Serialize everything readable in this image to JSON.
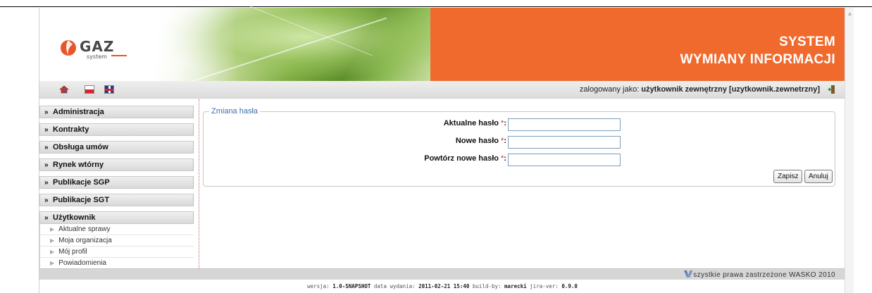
{
  "header": {
    "logo_text": "GAZ",
    "logo_subtext": "system",
    "title_line1": "SYSTEM",
    "title_line2": "WYMIANY INFORMACJI"
  },
  "toolbar": {
    "home_icon": "home-icon",
    "flags": [
      "pl-flag-icon",
      "uk-flag-icon"
    ],
    "logged_prefix": "zalogowany jako:",
    "logged_user": "użytkownik zewnętrzny [uzytkownik.zewnetrzny]",
    "logout_icon": "logout-icon"
  },
  "sidebar": {
    "items": [
      {
        "label": "Administracja",
        "expanded": false
      },
      {
        "label": "Kontrakty",
        "expanded": false
      },
      {
        "label": "Obsługa umów",
        "expanded": false
      },
      {
        "label": "Rynek wtórny",
        "expanded": false
      },
      {
        "label": "Publikacje SGP",
        "expanded": false
      },
      {
        "label": "Publikacje SGT",
        "expanded": false
      },
      {
        "label": "Użytkownik",
        "expanded": true
      }
    ],
    "subitems": [
      "Aktualne sprawy",
      "Moja organizacja",
      "Mój profil",
      "Powiadomienia"
    ]
  },
  "form": {
    "legend": "Zmiana hasła",
    "fields": [
      {
        "label": "Aktualne hasło",
        "required": "*",
        "colon": ":",
        "value": ""
      },
      {
        "label": "Nowe hasło",
        "required": "*",
        "colon": ":",
        "value": ""
      },
      {
        "label": "Powtórz nowe hasło",
        "required": "*",
        "colon": ":",
        "value": ""
      }
    ],
    "save_label": "Zapisz",
    "cancel_label": "Anuluj"
  },
  "footer": {
    "copyright": "szystkie prawa zastrzeżone WASKO 2010",
    "version_label": "wersja:",
    "version": "1.0-SNAPSHOT",
    "release_label": "data wydania:",
    "release_date": "2011-02-21 15:40",
    "build_label": "build-by:",
    "build_by": "marecki",
    "jira_label": "jira-ver:",
    "jira_ver": "0.9.0"
  },
  "colors": {
    "brand_orange": "#f06a2e",
    "legend_blue": "#3a6fb0",
    "required_red": "#e02020"
  }
}
